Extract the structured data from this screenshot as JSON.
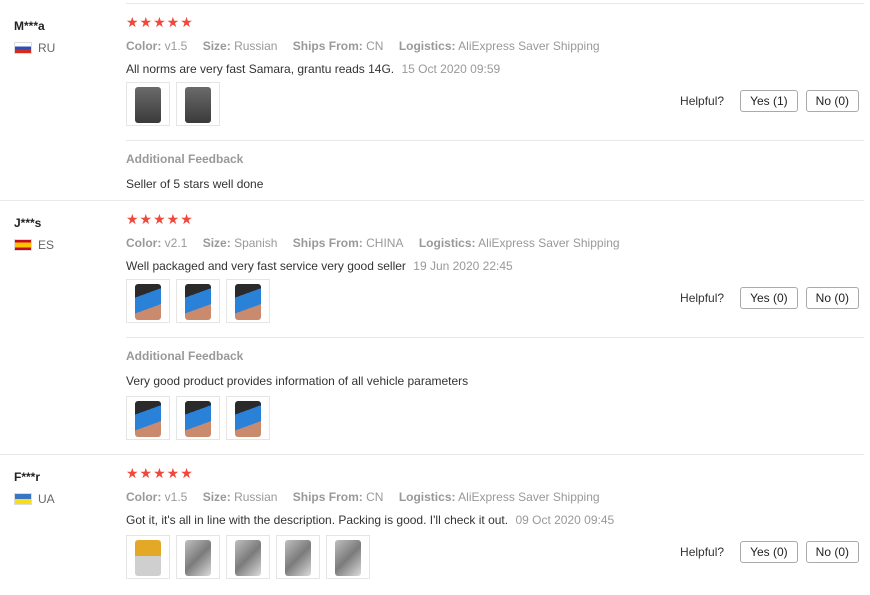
{
  "labels": {
    "color": "Color:",
    "size": "Size:",
    "ships_from": "Ships From:",
    "logistics": "Logistics:",
    "helpful": "Helpful?",
    "additional_feedback": "Additional Feedback"
  },
  "colors": {
    "star": "#f0483b",
    "muted": "#999999"
  },
  "reviews": [
    {
      "user": "M***a",
      "country": "RU",
      "flag": "flag-ru-icon",
      "stars": "★★★★★",
      "rating": 5,
      "color": "v1.5",
      "size": "Russian",
      "ships_from": "CN",
      "logistics": "AliExpress Saver Shipping",
      "text": "All norms are very fast Samara, grantu reads 14G.",
      "date": "15 Oct 2020 09:59",
      "yes": "Yes (1)",
      "no": "No (0)",
      "additional_text": "Seller of 5 stars well done"
    },
    {
      "user": "J***s",
      "country": "ES",
      "flag": "flag-es-icon",
      "stars": "★★★★★",
      "rating": 5,
      "color": "v2.1",
      "size": "Spanish",
      "ships_from": "CHINA",
      "logistics": "AliExpress Saver Shipping",
      "text": "Well packaged and very fast service very good seller",
      "date": "19 Jun 2020 22:45",
      "yes": "Yes (0)",
      "no": "No (0)",
      "additional_text": "Very good product provides information of all vehicle parameters"
    },
    {
      "user": "F***r",
      "country": "UA",
      "flag": "flag-ua-icon",
      "stars": "★★★★★",
      "rating": 5,
      "color": "v1.5",
      "size": "Russian",
      "ships_from": "CN",
      "logistics": "AliExpress Saver Shipping",
      "text": "Got it, it's all in line with the description. Packing is good. I'll check it out.",
      "date": "09 Oct 2020 09:45",
      "yes": "Yes (0)",
      "no": "No (0)"
    }
  ]
}
